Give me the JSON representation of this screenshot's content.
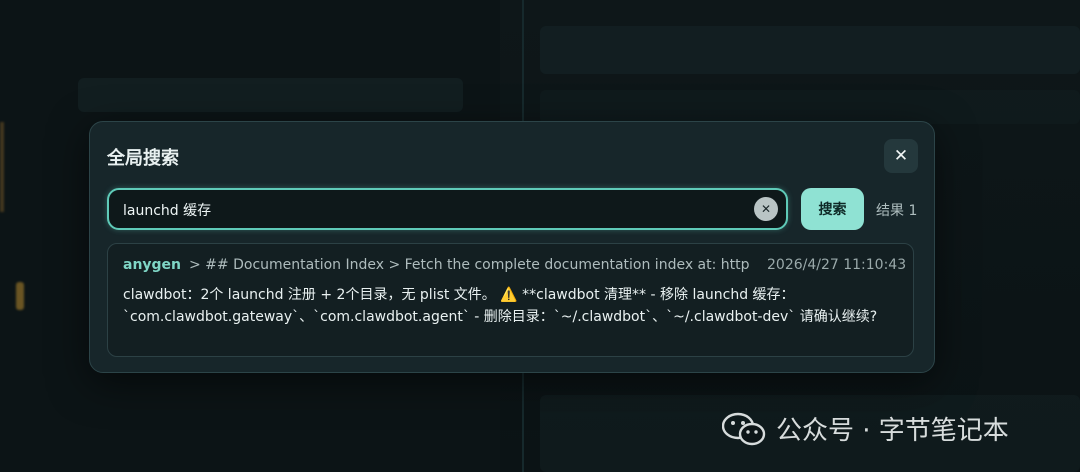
{
  "dialog": {
    "title": "全局搜索",
    "close_label": "✕"
  },
  "search": {
    "value": "launchd 缓存",
    "clear_label": "✕",
    "button_label": "搜索",
    "result_count": "结果 1"
  },
  "results": [
    {
      "source": "anygen",
      "path": "> ## Documentation Index > Fetch the complete documentation index at: https:/...",
      "timestamp": "2026/4/27 11:10:43",
      "snippet": "clawdbot：2个 launchd 注册 + 2个目录，无 plist 文件。 ⚠️ **clawdbot 清理** - 移除 launchd 缓存：`com.clawdbot.gateway`、`com.clawdbot.agent` - 删除目录：`~/.clawdbot`、`~/.clawdbot-dev` 请确认继续?"
    }
  ],
  "watermark": {
    "text": "公众号 · 字节笔记本"
  },
  "colors": {
    "accent": "#5fcab8",
    "search_button": "#8fe2d3",
    "source_name": "#7fd6c6",
    "modal_bg": "#17262a"
  }
}
